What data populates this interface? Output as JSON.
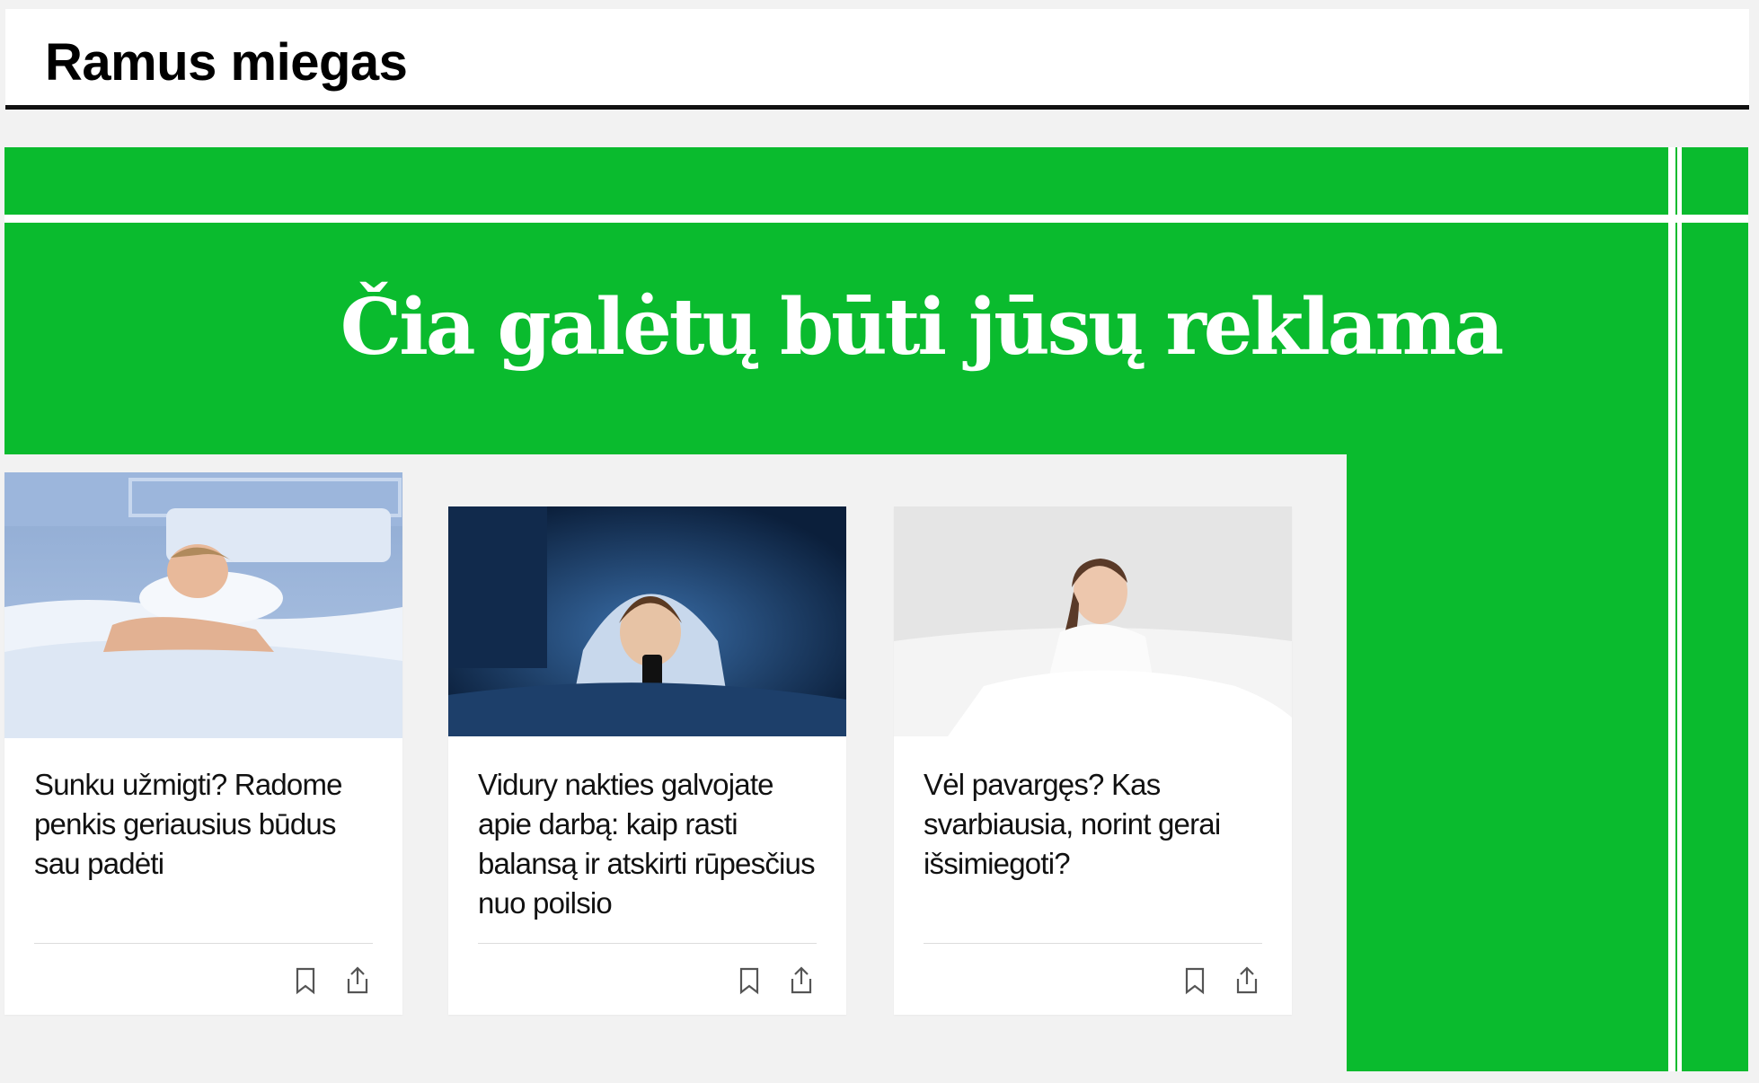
{
  "header": {
    "title": "Ramus miegas"
  },
  "ad": {
    "text": "Čia galėtų būti  jūsų reklama",
    "color": "#0abb2e"
  },
  "cards": [
    {
      "title": "Sunku užmigti? Radome penkis geriausius būdus sau padėti",
      "image": "woman-sleeping-peacefully-photo",
      "actions": [
        "bookmark-icon",
        "share-icon"
      ]
    },
    {
      "title": "Vidury nakties galvojate apie darbą: kaip rasti balansą ir atskirti rūpesčius nuo poilsio",
      "image": "woman-using-phone-under-blanket-photo",
      "actions": [
        "bookmark-icon",
        "share-icon"
      ]
    },
    {
      "title": "Vėl pavargęs? Kas svarbiausia, norint gerai išsimiegoti?",
      "image": "tired-woman-in-bed-photo",
      "actions": [
        "bookmark-icon",
        "share-icon"
      ]
    }
  ]
}
